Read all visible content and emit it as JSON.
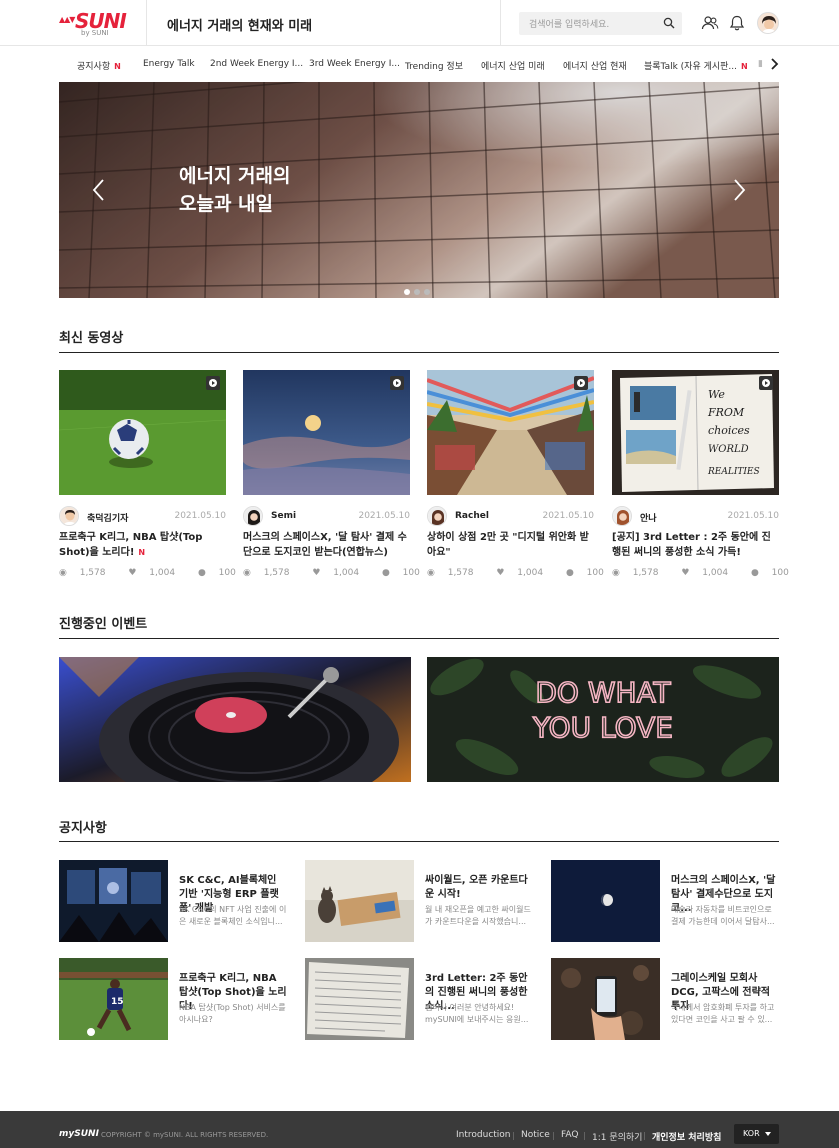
{
  "header": {
    "logo_text": "SUNI",
    "logo_by": "by SUNI",
    "page_title": "에너지 거래의 현재와 미래",
    "search_placeholder": "검색어를 입력하세요."
  },
  "tabs": [
    {
      "label": "공지사항",
      "badge": "N"
    },
    {
      "label": "Energy Talk",
      "badge": ""
    },
    {
      "label": "2nd Week Energy I...",
      "badge": ""
    },
    {
      "label": "3rd Week Energy I...",
      "badge": ""
    },
    {
      "label": "Trending 정보",
      "badge": ""
    },
    {
      "label": "에너지 산업 미래",
      "badge": ""
    },
    {
      "label": "에너지 산업 현재",
      "badge": ""
    },
    {
      "label": "블록Talk (자유 게시판...",
      "badge": "N"
    }
  ],
  "hero": {
    "line1": "에너지 거래의",
    "line2": "오늘과 내일",
    "slide_count": 3,
    "active_slide": 1
  },
  "videos": {
    "section_title": "최신 동영상",
    "items": [
      {
        "author": "축덕김기자",
        "date": "2021.05.10",
        "title": "프로축구 K리그, NBA 탑샷(Top Shot)을 노리다!",
        "badge": "N",
        "views": "1,578",
        "likes": "1,004",
        "comments": "100"
      },
      {
        "author": "Semi",
        "date": "2021.05.10",
        "title": "머스크의 스페이스X, '달 탐사' 결제 수단으로 도지코인 받는다(연합뉴스)",
        "badge": "",
        "views": "1,578",
        "likes": "1,004",
        "comments": "100"
      },
      {
        "author": "Rachel",
        "date": "2021.05.10",
        "title": "상하이 상점 2만 곳 \"디지털 위안화 받아요\"",
        "badge": "",
        "views": "1,578",
        "likes": "1,004",
        "comments": "100"
      },
      {
        "author": "안나",
        "date": "2021.05.10",
        "title": "[공지] 3rd Letter : 2주 동안에 진행된 써니의 풍성한 소식 가득!",
        "badge": "",
        "views": "1,578",
        "likes": "1,004",
        "comments": "100"
      }
    ]
  },
  "events": {
    "section_title": "진행중인 이벤트",
    "neon_text_1": "DO WHAT",
    "neon_text_2": "YOU LOVE"
  },
  "notices": {
    "section_title": "공지사항",
    "items": [
      {
        "title": "SK C&C, AI블록체인 기반 '지능형 ERP 플랫폼' 개발",
        "desc": "SK C&C의 NFT 사업 진출에 이은 새로운 블록체인 소식입니..."
      },
      {
        "title": "싸이월드, 오픈 카운트다운 시작!",
        "desc": "월 내 재오픈을 예고한 싸이월드가 카운트다운을 시작했습니..."
      },
      {
        "title": "머스크의 스페이스X, '달 탐사' 결제수단으로 도지코...",
        "desc": "테슬라 자동차를 비트코인으로 결제 가능한데 이어서 달탐사..."
      },
      {
        "title": "프로축구 K리그, NBA 탑샷(Top Shot)을 노리다!",
        "desc": "NBA 탑샷(Top Shot) 서비스를 아시나요?"
      },
      {
        "title": "3rd Letter: 2주 동안의 진행된 써니의 풍성한 소식...",
        "desc": "멤버사 여러분 안녕하세요! mySUNI에 보내주시는 응원..."
      },
      {
        "title": "그레이스케일 모회사 DCG, 고팍스에 전략적 투자",
        "desc": "국내에서 암호화폐 투자를 하고 있다면 코인을 사고 팔 수 있..."
      }
    ]
  },
  "footer": {
    "logo": "mySUNI",
    "copyright": "COPYRIGHT © mySUNI. ALL RIGHTS RESERVED.",
    "links": [
      "Introduction",
      "Notice",
      "FAQ",
      "1:1 문의하기",
      "개인정보 처리방침"
    ],
    "language": "KOR"
  },
  "colors": {
    "accent": "#e5223b",
    "footer_bg": "#3a3a3a"
  }
}
